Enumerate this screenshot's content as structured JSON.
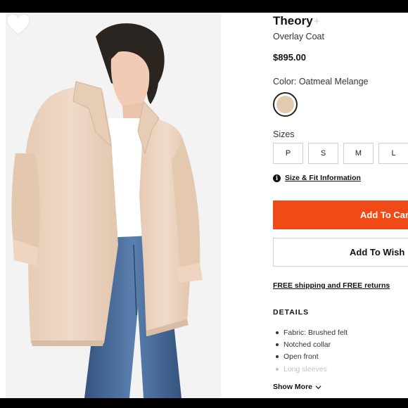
{
  "product": {
    "brand": "Theory",
    "brand_plus": "+",
    "name": "Overlay Coat",
    "price": "$895.00"
  },
  "color": {
    "label": "Color: Oatmeal Melange",
    "swatch_hex": "#e3c9b0"
  },
  "sizes": {
    "label": "Sizes",
    "options": [
      "P",
      "S",
      "M",
      "L"
    ]
  },
  "size_fit_link": "Size & Fit Information",
  "buttons": {
    "add_to_cart": "Add To Cart",
    "add_to_wishlist": "Add To Wish"
  },
  "shipping_text": "FREE shipping and FREE returns",
  "details": {
    "title": "DETAILS",
    "items": [
      "Fabric: Brushed felt",
      "Notched collar",
      "Open front",
      "Long sleeves"
    ]
  },
  "show_more": "Show More",
  "colors": {
    "accent": "#f04b17",
    "coat": "#ecd4bf",
    "jeans": "#3d5f8f"
  },
  "icons": {
    "wishlist": "heart-icon",
    "info": "info-icon",
    "show_more": "chevron-down-icon"
  }
}
